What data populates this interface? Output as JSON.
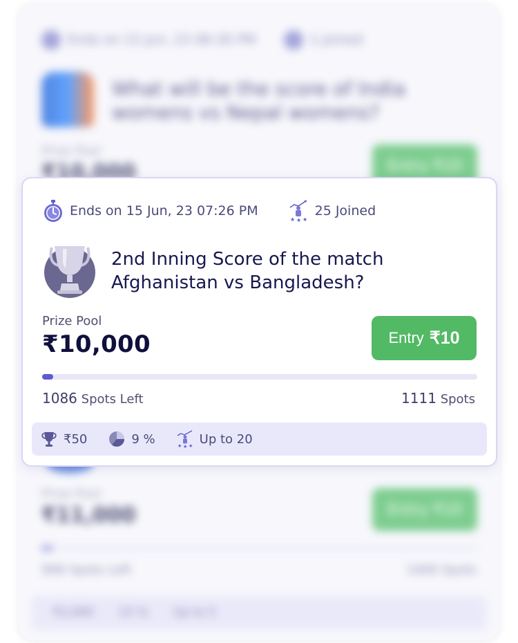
{
  "background_cards": [
    {
      "end_time": "Ends on 15 Jun, 23  06:30 PM",
      "joined": "1 Joined",
      "question": "What will be the score of India womens vs Nepal womens?",
      "prize_label": "Prize Pool",
      "prize_value": "₹10,000",
      "entry_label": "Entry ₹10"
    },
    {
      "prize_label": "Prize Pool",
      "prize_value": "₹11,000",
      "entry_label": "Entry ₹10",
      "spots_left": "999 Spots Left",
      "spots_total": "1000 Spots",
      "footer": [
        "₹2,000",
        "15 %",
        "Up to 5"
      ]
    }
  ],
  "card": {
    "end_time": "Ends on 15 Jun, 23  07:26 PM",
    "joined": "25 Joined",
    "question_line1": "2nd Inning Score of the match",
    "question_line2": "Afghanistan vs Bangladesh?",
    "prize_label": "Prize Pool",
    "prize_value": "₹10,000",
    "entry_label": "Entry",
    "entry_amount": "₹10",
    "progress_fraction": 0.025,
    "spots_left_num": "1086",
    "spots_left_label": "Spots Left",
    "spots_total_num": "1111",
    "spots_total_label": "Spots",
    "footer": {
      "first_prize": "₹50",
      "win_percent": "9 %",
      "max_entries": "Up to 20"
    }
  },
  "icons": {
    "timer": "stopwatch-icon",
    "joined": "users-joined-icon",
    "trophy": "trophy-icon",
    "first_prize": "trophy-small-icon",
    "win_percent": "pie-chart-icon",
    "max_entries": "entries-icon"
  },
  "colors": {
    "accent": "#5d5ccf",
    "entry_button": "#52b964",
    "footer_bg": "#e9e8fb",
    "text_dark": "#10103e"
  }
}
